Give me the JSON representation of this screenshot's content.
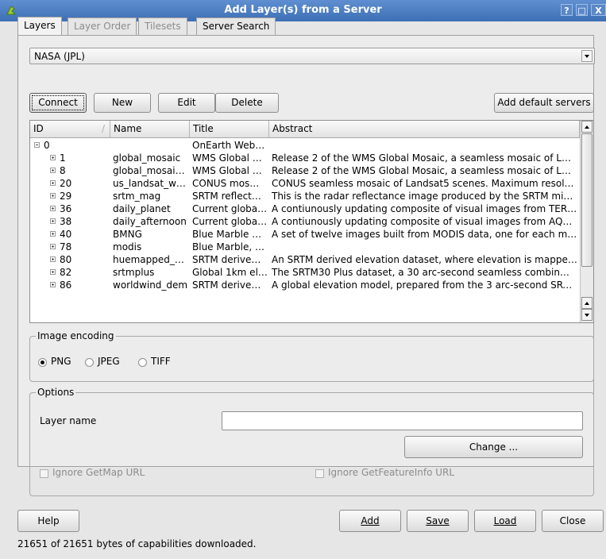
{
  "window": {
    "title": "Add Layer(s) from a Server",
    "buttons": [
      "?",
      "□",
      "X"
    ]
  },
  "tabs": [
    {
      "label": "Layers",
      "state": "active"
    },
    {
      "label": "Layer Order",
      "state": "disabled"
    },
    {
      "label": "Tilesets",
      "state": "disabled"
    },
    {
      "label": "Server Search",
      "state": "normal"
    }
  ],
  "server": {
    "selected": "NASA (JPL)"
  },
  "connection_buttons": {
    "connect": "Connect",
    "new": "New",
    "edit": "Edit",
    "delete": "Delete",
    "add_default": "Add default servers"
  },
  "layer_table": {
    "columns": [
      "ID",
      "Name",
      "Title",
      "Abstract"
    ],
    "sort_indicator": "/",
    "rows": [
      {
        "id": "0",
        "name": "",
        "title": "OnEarth Web…",
        "abstract": "",
        "expanded": true,
        "level": 0
      },
      {
        "id": "1",
        "name": "global_mosaic",
        "title": "WMS Global …",
        "abstract": "Release 2 of the WMS Global Mosaic, a seamless mosaic of L…",
        "level": 1
      },
      {
        "id": "8",
        "name": "global_mosai…",
        "title": "WMS Global …",
        "abstract": "Release 2 of the WMS Global Mosaic, a seamless mosaic of L…",
        "level": 1
      },
      {
        "id": "20",
        "name": "us_landsat_w…",
        "title": "CONUS mos…",
        "abstract": "CONUS seamless mosaic of Landsat5 scenes. Maximum resol…",
        "level": 1
      },
      {
        "id": "29",
        "name": "srtm_mag",
        "title": "SRTM reflect…",
        "abstract": "This is the radar reflectance image produced by the SRTM mis…",
        "level": 1
      },
      {
        "id": "36",
        "name": "daily_planet",
        "title": "Current global…",
        "abstract": "A contiunously updating composite of visual images from TER…",
        "level": 1
      },
      {
        "id": "38",
        "name": "daily_afternoon",
        "title": "Current global…",
        "abstract": "A contiunously updating composite of visual images from AQU…",
        "level": 1
      },
      {
        "id": "40",
        "name": "BMNG",
        "title": "Blue Marble …",
        "abstract": "A set of twelve images built from MODIS data, one for each m…",
        "level": 1
      },
      {
        "id": "78",
        "name": "modis",
        "title": "Blue Marble, …",
        "abstract": "",
        "level": 1
      },
      {
        "id": "80",
        "name": "huemapped_…",
        "title": "SRTM derive…",
        "abstract": "An SRTM derived elevation dataset, where elevation is mappe…",
        "level": 1
      },
      {
        "id": "82",
        "name": "srtmplus",
        "title": "Global 1km el…",
        "abstract": "The SRTM30 Plus dataset, a 30 arc-second seamless combin…",
        "level": 1
      },
      {
        "id": "86",
        "name": "worldwind_dem",
        "title": "SRTM derive…",
        "abstract": "A global elevation model, prepared from the 3 arc-second SRT…",
        "level": 1
      }
    ]
  },
  "image_encoding": {
    "title": "Image encoding",
    "options": [
      "PNG",
      "JPEG",
      "TIFF"
    ],
    "selected": "PNG"
  },
  "options": {
    "title": "Options",
    "layer_name_label": "Layer name",
    "layer_name_value": "",
    "change_button": "Change ...",
    "ignore_getmap": "Ignore GetMap URL",
    "ignore_getfeatureinfo": "Ignore GetFeatureInfo URL"
  },
  "footer": {
    "help": "Help",
    "add": "Add",
    "save": "Save",
    "load": "Load",
    "close": "Close"
  },
  "status": "21651 of 21651 bytes of capabilities downloaded."
}
